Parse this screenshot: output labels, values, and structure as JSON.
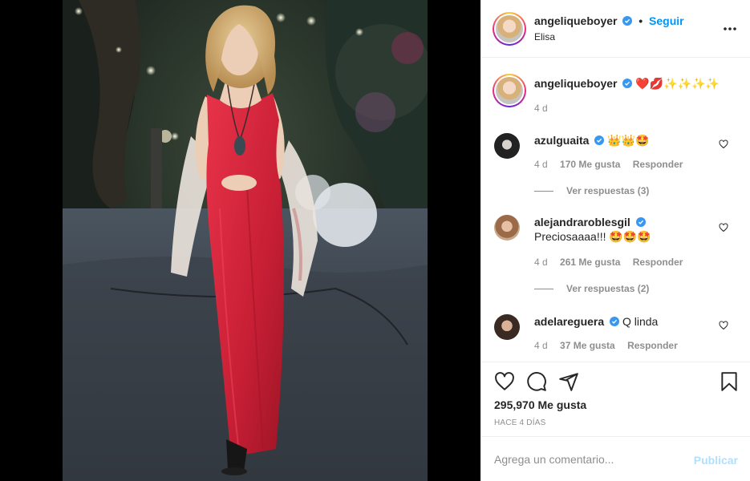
{
  "post": {
    "username": "angeliqueboyer",
    "follow_label": "Seguir",
    "location": "Elisa",
    "more_icon": "more-options-icon"
  },
  "caption": {
    "username": "angeliqueboyer",
    "text": "❤️💋✨✨✨✨",
    "time": "4 d"
  },
  "comments": [
    {
      "username": "azulguaita",
      "text": "👑👑🤩",
      "time": "4 d",
      "likes": "170 Me gusta",
      "reply_label": "Responder",
      "view_replies": "Ver respuestas (3)"
    },
    {
      "username": "alejandraroblesgil",
      "text": "Preciosaaaa!!! 🤩🤩🤩",
      "time": "4 d",
      "likes": "261 Me gusta",
      "reply_label": "Responder",
      "view_replies": "Ver respuestas (2)"
    },
    {
      "username": "adelareguera",
      "text": "Q linda",
      "time": "4 d",
      "likes": "37 Me gusta",
      "reply_label": "Responder"
    }
  ],
  "actions": {
    "like_icon": "heart-icon",
    "comment_icon": "comment-icon",
    "share_icon": "share-icon",
    "save_icon": "bookmark-icon",
    "likes_count": "295,970 Me gusta",
    "date": "HACE 4 DÍAS"
  },
  "add_comment": {
    "placeholder": "Agrega un comentario...",
    "publish_label": "Publicar"
  },
  "colors": {
    "link": "#0095f6",
    "publish_disabled": "#b2dffc",
    "muted": "#8e8e8e",
    "verified": "#3897f0"
  }
}
